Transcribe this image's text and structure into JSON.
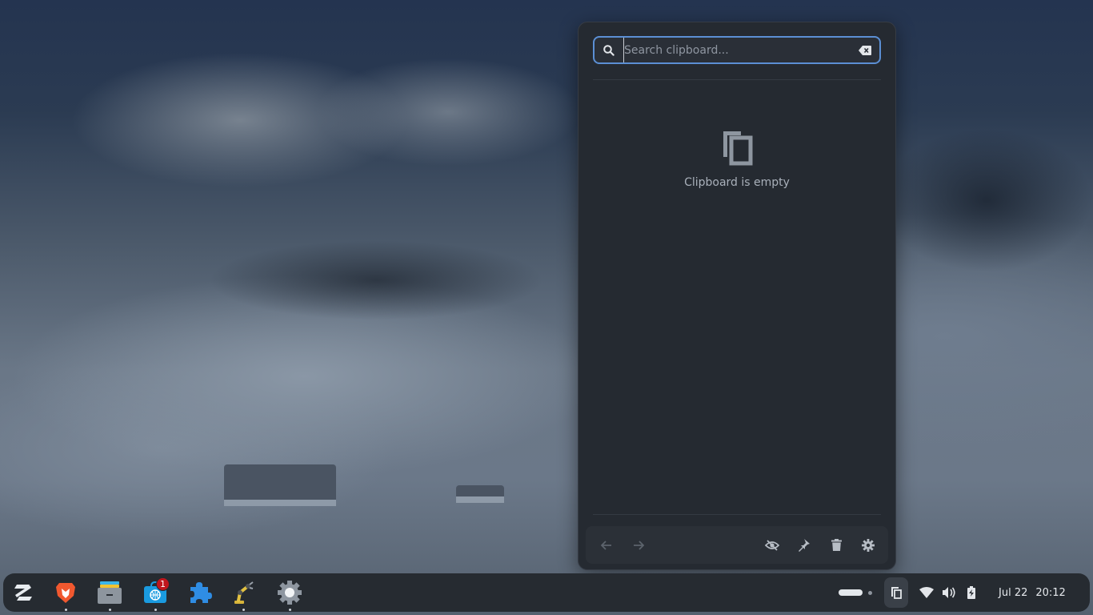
{
  "clipboard": {
    "search_placeholder": "Search clipboard...",
    "search_value": "",
    "empty_message": "Clipboard is empty",
    "toolbar": {
      "back_icon": "arrow-left-icon",
      "forward_icon": "arrow-right-icon",
      "private_mode_icon": "eye-off-icon",
      "pin_icon": "pin-icon",
      "clear_icon": "trash-icon",
      "settings_icon": "gear-icon"
    }
  },
  "taskbar": {
    "apps": [
      {
        "name": "zorin-menu",
        "icon": "zorin-logo-icon"
      },
      {
        "name": "brave-browser",
        "icon": "brave-lion-icon"
      },
      {
        "name": "files",
        "icon": "folder-icon"
      },
      {
        "name": "software-store",
        "icon": "store-bag-icon",
        "badge": "1"
      },
      {
        "name": "extensions",
        "icon": "puzzle-piece-icon"
      },
      {
        "name": "tweaks",
        "icon": "robot-arm-icon"
      },
      {
        "name": "settings",
        "icon": "gear-icon"
      }
    ],
    "tray": {
      "workspaces": {
        "active": 1,
        "count": 2
      },
      "clipboard_icon": "clipboard-icon",
      "wifi_icon": "wifi-icon",
      "volume_icon": "speaker-icon",
      "battery_icon": "battery-charging-icon"
    },
    "clock": {
      "date": "Jul 22",
      "time": "20:12"
    }
  },
  "colors": {
    "accent": "#5b8fd4",
    "popup_bg": "#252a31",
    "taskbar_bg": "#262b31",
    "badge": "#c0161d"
  }
}
